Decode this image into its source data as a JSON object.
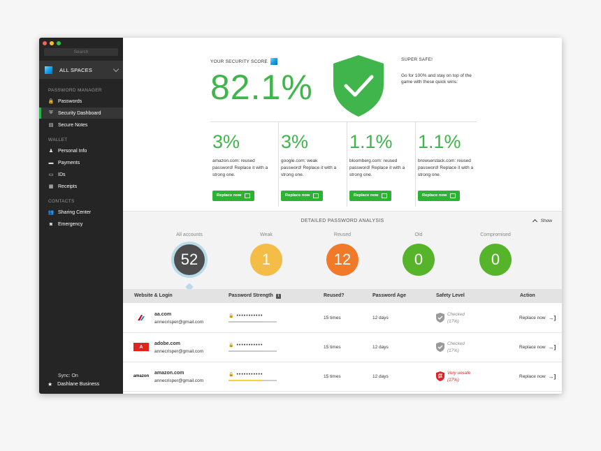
{
  "colors": {
    "accent": "#3fb54b",
    "button": "#2db236",
    "sidebar": "#252525",
    "weak": "#f3bd47",
    "reused": "#f07a2a",
    "old": "#56b42a",
    "compromised": "#56b42a",
    "danger": "#e02424"
  },
  "sidebar": {
    "search_placeholder": "Search",
    "spaces_label": "ALL SPACES",
    "sections": [
      {
        "title": "PASSWORD MANAGER",
        "items": [
          {
            "label": "Passwords",
            "icon": "lock-icon"
          },
          {
            "label": "Security Dashboard",
            "icon": "shield-icon",
            "active": true
          },
          {
            "label": "Secure Notes",
            "icon": "note-icon"
          }
        ]
      },
      {
        "title": "WALLET",
        "items": [
          {
            "label": "Personal Info",
            "icon": "person-icon"
          },
          {
            "label": "Payments",
            "icon": "card-icon"
          },
          {
            "label": "IDs",
            "icon": "id-icon"
          },
          {
            "label": "Receipts",
            "icon": "receipt-icon"
          }
        ]
      },
      {
        "title": "CONTACTS",
        "items": [
          {
            "label": "Sharing Center",
            "icon": "people-icon"
          },
          {
            "label": "Emergency",
            "icon": "camera-icon"
          }
        ]
      }
    ],
    "sync": "Sync: On",
    "business": "Dashlane Business"
  },
  "score": {
    "label": "YOUR SECURITY SCORE",
    "value": "82.1%",
    "status_title": "SUPER SAFE!",
    "status_desc": "Go for 100% and stay on top of the game with these quick wins:"
  },
  "wins": [
    {
      "pct": "3%",
      "desc": "amazon.com: reused password! Replace it with a strong one.",
      "button": "Replace now"
    },
    {
      "pct": "3%",
      "desc": "google.com: weak password! Replace it with a strong one.",
      "button": "Replace now"
    },
    {
      "pct": "1.1%",
      "desc": "bloomberg.com: reused password! Replace it with a strong one.",
      "button": "Replace now"
    },
    {
      "pct": "1.1%",
      "desc": "browserstack.com: reused password! Replace it with a strong one.",
      "button": "Replace now"
    }
  ],
  "analysis": {
    "title": "DETAILED PASSWORD ANALYSIS",
    "show": "Show",
    "stats": [
      {
        "label": "All accounts",
        "value": "52"
      },
      {
        "label": "Weak",
        "value": "1"
      },
      {
        "label": "Reused",
        "value": "12"
      },
      {
        "label": "Old",
        "value": "0"
      },
      {
        "label": "Compromised",
        "value": "0"
      }
    ]
  },
  "table": {
    "headers": [
      "Website & Login",
      "Password Strength",
      "Reused?",
      "Password Age",
      "Safety Level",
      "Action"
    ],
    "info_glyph": "i",
    "rows": [
      {
        "site": "aa.com",
        "email": "annecrisper@gmail.com",
        "password": "•••••••••••",
        "strength": 0.7,
        "strength_color": "#c8c8c8",
        "reused": "15 times",
        "age": "12 days",
        "level": "Checked",
        "level_pct": "(17%)",
        "safe": true,
        "action": "Replace now",
        "logo": "aa-logo"
      },
      {
        "site": "adobe.com",
        "email": "annecrisper@gmail.com",
        "password": "•••••••••••",
        "strength": 0.7,
        "strength_color": "#c8c8c8",
        "reused": "15 times",
        "age": "12 days",
        "level": "Checked",
        "level_pct": "(17%)",
        "safe": true,
        "action": "Replace now",
        "logo": "adobe-logo",
        "logo_text": "A"
      },
      {
        "site": "amazon.com",
        "email": "annecrisper@gmail.com",
        "password": "•••••••••••",
        "strength": 0.7,
        "strength_color": "#f2d533",
        "reused": "15 times",
        "age": "12 days",
        "level": "Very unsafe",
        "level_pct": "(17%)",
        "safe": false,
        "action": "Replace now",
        "logo": "amazon-logo",
        "logo_text": "amazon"
      }
    ]
  }
}
